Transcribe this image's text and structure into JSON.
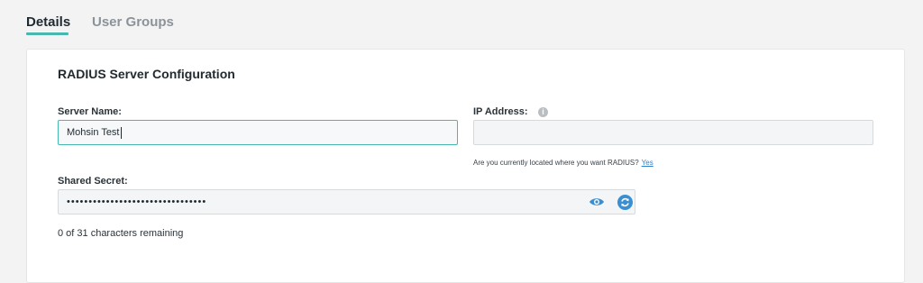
{
  "tabs": [
    {
      "label": "Details",
      "active": true
    },
    {
      "label": "User Groups",
      "active": false
    }
  ],
  "colors": {
    "accent": "#48b7b0",
    "link": "#2f7fc8",
    "icon_blue": "#3b8fd0"
  },
  "card": {
    "title": "RADIUS Server Configuration",
    "server_name": {
      "label": "Server Name:",
      "value": "Mohsin Test"
    },
    "ip_address": {
      "label": "IP Address:",
      "value": "",
      "info_icon": "info-circle-icon",
      "hint_text": "Are you currently located where you want RADIUS?",
      "hint_link": "Yes"
    },
    "shared_secret": {
      "label": "Shared Secret:",
      "masked_value": "••••••••••••••••••••••••••••••••",
      "show_icon": "eye-icon",
      "regenerate_icon": "refresh-icon",
      "remaining_text": "0 of 31 characters remaining"
    }
  }
}
